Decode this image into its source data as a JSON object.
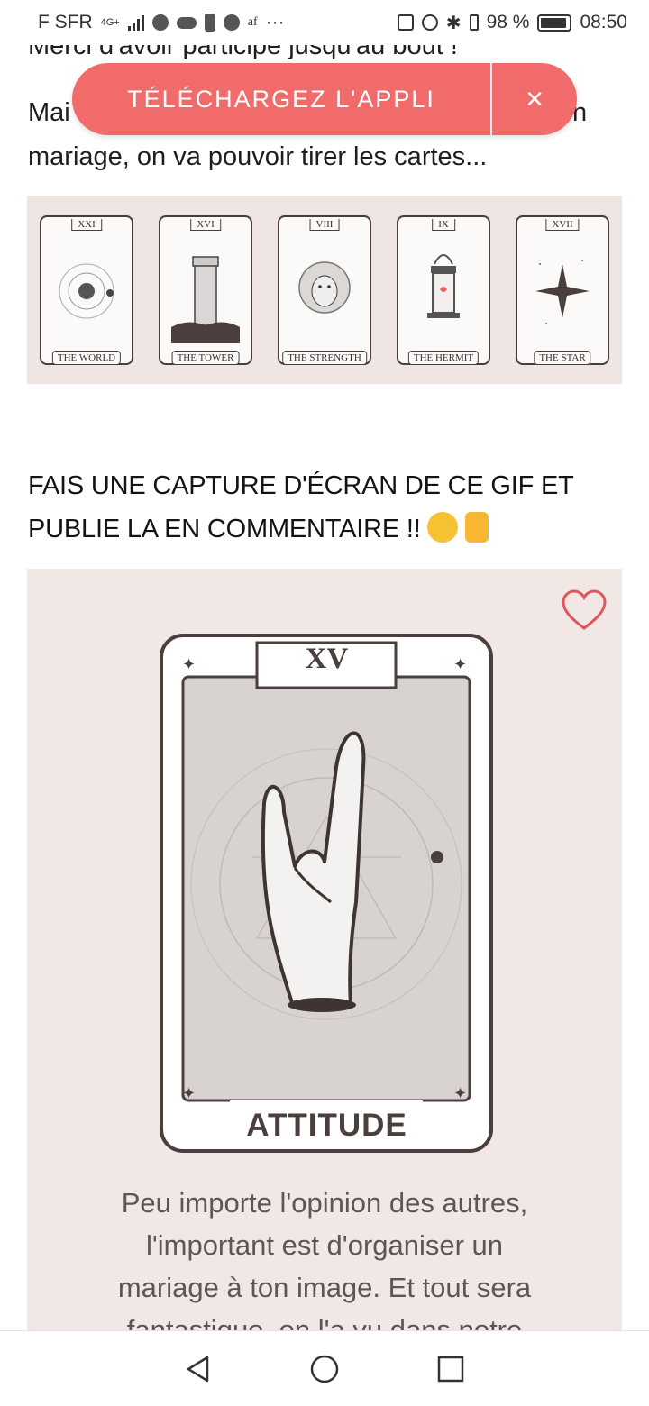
{
  "status_bar": {
    "carrier": "F SFR",
    "network": "4G+",
    "small_text": "af",
    "more": "···",
    "battery": "98 %",
    "time": "08:50"
  },
  "article": {
    "line1": "Merci d'avoir participé jusqu'au bout !",
    "line2_start": "Mai",
    "line2_end": "n",
    "line3": "mariage, on va pouvoir tirer les cartes..."
  },
  "banner": {
    "label": "TÉLÉCHARGEZ L'APPLI",
    "close": "×",
    "color": "#f26b6b"
  },
  "cards": [
    {
      "number": "XXI",
      "name": "THE WORLD",
      "icon": "planet-icon"
    },
    {
      "number": "XVI",
      "name": "THE TOWER",
      "icon": "tower-icon"
    },
    {
      "number": "VIII",
      "name": "THE STRENGTH",
      "icon": "lion-icon"
    },
    {
      "number": "IX",
      "name": "THE HERMIT",
      "icon": "lantern-icon"
    },
    {
      "number": "XVII",
      "name": "THE STAR",
      "icon": "star-icon"
    }
  ],
  "heading": {
    "text": "FAIS UNE CAPTURE D'ÉCRAN DE CE GIF ET PUBLIE LA EN COMMENTAIRE !!",
    "emoji1": "monocle-face-emoji",
    "emoji2": "pointing-down-emoji"
  },
  "gif": {
    "card_number": "XV",
    "card_title": "ATTITUDE",
    "text_lines": [
      "Peu importe l'opinion des autres,",
      "l'important est d'organiser un",
      "mariage à ton image. Et tout sera",
      "fantastique, on l'a vu dans notre"
    ],
    "heart_color": "#e0575b"
  },
  "nav": {
    "back": "back-icon",
    "home": "home-icon",
    "recents": "recents-icon"
  }
}
